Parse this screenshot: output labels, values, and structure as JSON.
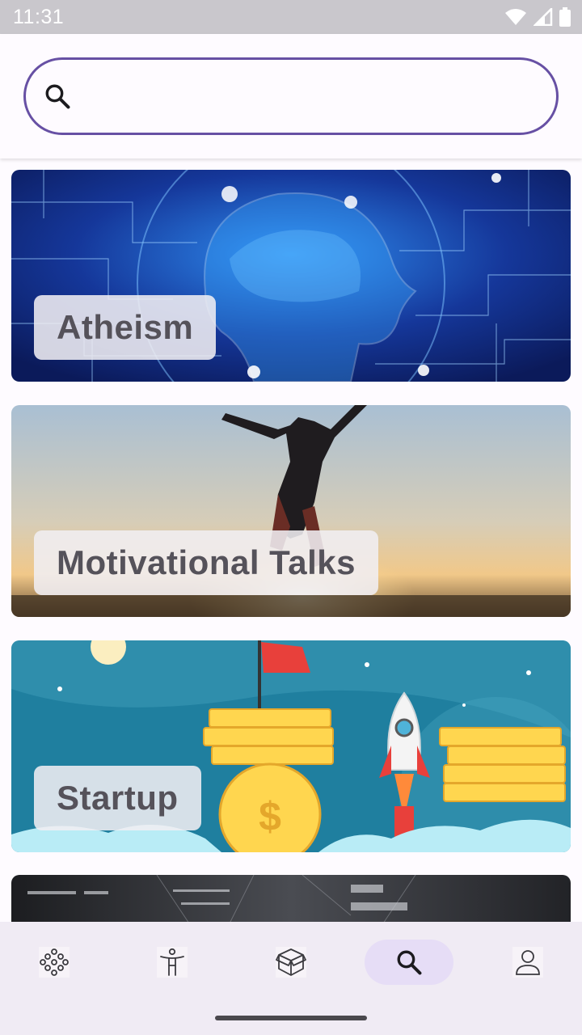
{
  "status_bar": {
    "time": "11:31"
  },
  "search": {
    "value": "",
    "placeholder": ""
  },
  "topics": [
    {
      "label": "Atheism"
    },
    {
      "label": "Motivational Talks"
    },
    {
      "label": "Startup"
    }
  ],
  "nav": {
    "items": [
      {
        "icon": "bubbles-icon",
        "active": false
      },
      {
        "icon": "person-icon",
        "active": false
      },
      {
        "icon": "box-icon",
        "active": false
      },
      {
        "icon": "search-icon",
        "active": true
      },
      {
        "icon": "account-icon",
        "active": false
      }
    ]
  },
  "colors": {
    "accent": "#6750a4",
    "nav_active": "#e6ddf6",
    "nav_bg": "#f0ebf4"
  }
}
